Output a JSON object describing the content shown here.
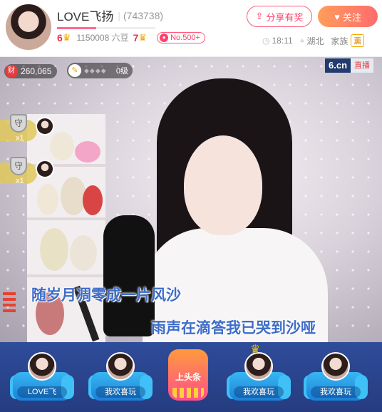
{
  "header": {
    "host_name": "LOVE飞扬",
    "host_id": "(743738)",
    "badge_level": "6",
    "beans": "1150008 六豆",
    "crown_level": "7",
    "rank_badge": "No.500+",
    "share_label": "分享有奖",
    "follow_label": "关注",
    "time": "18:11",
    "location": "湖北",
    "family_label": "家族",
    "family_badge": "薰"
  },
  "video": {
    "wealth": "260,065",
    "wealth_icon": "财",
    "level": "0级",
    "brand_logo": "6.cn",
    "live_label": "直播",
    "guards": [
      {
        "shield": "守",
        "count": "x1"
      },
      {
        "shield": "守",
        "count": "x1"
      }
    ],
    "lyrics": [
      "随岁月凋零成一片风沙",
      "雨声在滴答我已哭到沙哑"
    ]
  },
  "seats": {
    "items": [
      {
        "label": "LOVE飞"
      },
      {
        "label": "我欢喜玩"
      },
      {
        "label": "我欢喜玩"
      },
      {
        "label": "我欢喜玩"
      }
    ],
    "headline_label": "上头条"
  },
  "colors": {
    "accent_pink": "#ff3f6c",
    "follow_gradient_start": "#ff9d5c",
    "lyric_blue": "#3e6cc8",
    "seat_bg": "#2f4c9a"
  }
}
